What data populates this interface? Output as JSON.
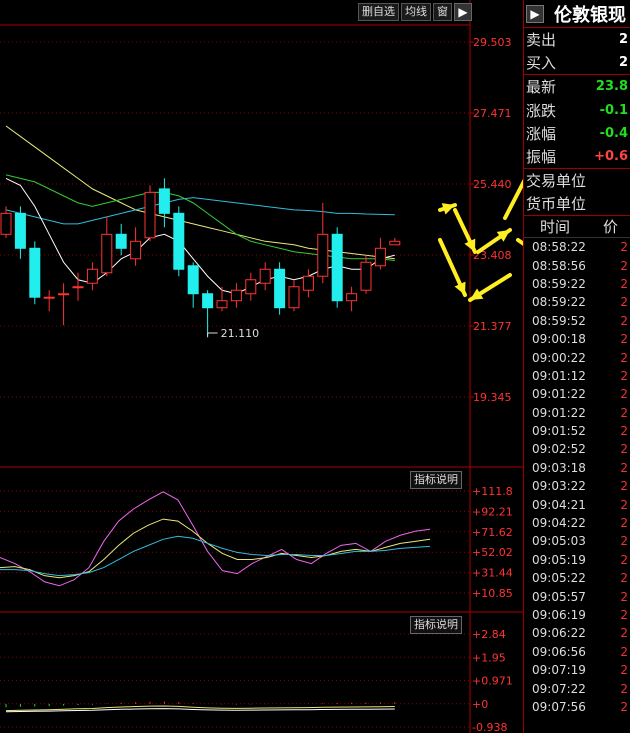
{
  "toolbar": {
    "delete_label": "删自选",
    "ma_label": "均线",
    "window_label": "窗",
    "arrow_icon": "play-icon"
  },
  "main_axis": {
    "labels": [
      "29.503",
      "27.471",
      "25.440",
      "23.408",
      "21.377",
      "19.345"
    ]
  },
  "min_label": "21.110",
  "indicator1": {
    "button_label": "指标说明",
    "labels": [
      "+111.8",
      "+92.21",
      "+71.62",
      "+52.02",
      "+31.44",
      "+10.85"
    ]
  },
  "indicator2": {
    "button_label": "指标说明",
    "labels": [
      "+2.84",
      "+1.95",
      "+0.971",
      "+0",
      "-0.938"
    ]
  },
  "panel": {
    "title": "伦敦银现",
    "rows": [
      {
        "label": "卖出",
        "value": "2",
        "color": "#ffffff"
      },
      {
        "label": "买入",
        "value": "2",
        "color": "#ffffff"
      },
      {
        "label": "最新",
        "value": "23.8",
        "color": "#22dd22"
      },
      {
        "label": "涨跌",
        "value": "-0.1",
        "color": "#22dd22"
      },
      {
        "label": "涨幅",
        "value": "-0.4",
        "color": "#22dd22"
      },
      {
        "label": "振幅",
        "value": "+0.6",
        "color": "#ff4444"
      },
      {
        "label": "交易单位",
        "value": "",
        "color": "#ffffff"
      },
      {
        "label": "货币单位",
        "value": "",
        "color": "#ffffff"
      }
    ],
    "tick_header": {
      "time": "时间",
      "price": "价"
    },
    "ticks": [
      {
        "time": "08:58:22",
        "value": "2"
      },
      {
        "time": "08:58:56",
        "value": "2"
      },
      {
        "time": "08:59:22",
        "value": "2"
      },
      {
        "time": "08:59:22",
        "value": "2"
      },
      {
        "time": "08:59:52",
        "value": "2"
      },
      {
        "time": "09:00:18",
        "value": "2"
      },
      {
        "time": "09:00:22",
        "value": "2"
      },
      {
        "time": "09:01:12",
        "value": "2"
      },
      {
        "time": "09:01:22",
        "value": "2"
      },
      {
        "time": "09:01:22",
        "value": "2"
      },
      {
        "time": "09:01:52",
        "value": "2"
      },
      {
        "time": "09:02:52",
        "value": "2"
      },
      {
        "time": "09:03:18",
        "value": "2"
      },
      {
        "time": "09:03:22",
        "value": "2"
      },
      {
        "time": "09:04:21",
        "value": "2"
      },
      {
        "time": "09:04:22",
        "value": "2"
      },
      {
        "time": "09:05:03",
        "value": "2"
      },
      {
        "time": "09:05:19",
        "value": "2"
      },
      {
        "time": "09:05:22",
        "value": "2"
      },
      {
        "time": "09:05:57",
        "value": "2"
      },
      {
        "time": "09:06:19",
        "value": "2"
      },
      {
        "time": "09:06:22",
        "value": "2"
      },
      {
        "time": "09:06:56",
        "value": "2"
      },
      {
        "time": "09:07:19",
        "value": "2"
      },
      {
        "time": "09:07:22",
        "value": "2"
      },
      {
        "time": "09:07:56",
        "value": "2"
      }
    ]
  },
  "colors": {
    "up": "#ff3333",
    "down": "#22eeee",
    "ma_yellow": "#e8e87a",
    "ma_white": "#ffffff",
    "ma_green": "#33cc33",
    "ma_cyan": "#33bbdd",
    "ma_magenta": "#ee66ee",
    "arrow_yellow": "#ffee22"
  },
  "chart_data": {
    "type": "candlestick",
    "ylim": [
      19.345,
      29.503
    ],
    "min_price": 21.11,
    "candles": [
      {
        "o": 24.0,
        "c": 24.6,
        "h": 24.8,
        "l": 23.9
      },
      {
        "o": 24.6,
        "c": 23.6,
        "h": 24.8,
        "l": 23.3
      },
      {
        "o": 23.6,
        "c": 22.2,
        "h": 23.8,
        "l": 22.0
      },
      {
        "o": 22.2,
        "c": 22.2,
        "h": 22.4,
        "l": 21.8
      },
      {
        "o": 22.3,
        "c": 22.3,
        "h": 22.6,
        "l": 21.4
      },
      {
        "o": 22.5,
        "c": 22.5,
        "h": 22.9,
        "l": 22.1
      },
      {
        "o": 22.6,
        "c": 23.0,
        "h": 23.2,
        "l": 22.4
      },
      {
        "o": 22.9,
        "c": 24.0,
        "h": 24.5,
        "l": 22.8
      },
      {
        "o": 24.0,
        "c": 23.6,
        "h": 24.3,
        "l": 23.4
      },
      {
        "o": 23.3,
        "c": 23.8,
        "h": 24.2,
        "l": 23.1
      },
      {
        "o": 23.9,
        "c": 25.2,
        "h": 25.4,
        "l": 23.8
      },
      {
        "o": 25.3,
        "c": 24.6,
        "h": 25.6,
        "l": 24.2
      },
      {
        "o": 24.6,
        "c": 23.0,
        "h": 24.8,
        "l": 22.8
      },
      {
        "o": 23.1,
        "c": 22.3,
        "h": 23.2,
        "l": 21.9
      },
      {
        "o": 22.3,
        "c": 21.9,
        "h": 22.4,
        "l": 21.1
      },
      {
        "o": 21.9,
        "c": 22.1,
        "h": 22.5,
        "l": 21.8
      },
      {
        "o": 22.1,
        "c": 22.4,
        "h": 22.6,
        "l": 21.9
      },
      {
        "o": 22.3,
        "c": 22.7,
        "h": 22.9,
        "l": 22.1
      },
      {
        "o": 22.6,
        "c": 23.0,
        "h": 23.2,
        "l": 22.4
      },
      {
        "o": 23.0,
        "c": 21.9,
        "h": 23.2,
        "l": 21.7
      },
      {
        "o": 21.9,
        "c": 22.5,
        "h": 22.7,
        "l": 21.8
      },
      {
        "o": 22.4,
        "c": 22.8,
        "h": 23.0,
        "l": 22.2
      },
      {
        "o": 22.8,
        "c": 24.0,
        "h": 24.9,
        "l": 22.6
      },
      {
        "o": 24.0,
        "c": 22.1,
        "h": 24.2,
        "l": 21.9
      },
      {
        "o": 22.1,
        "c": 22.3,
        "h": 22.5,
        "l": 21.8
      },
      {
        "o": 22.4,
        "c": 23.2,
        "h": 23.4,
        "l": 22.3
      },
      {
        "o": 23.1,
        "c": 23.6,
        "h": 23.9,
        "l": 23.0
      },
      {
        "o": 23.7,
        "c": 23.8,
        "h": 23.9,
        "l": 23.7
      }
    ],
    "ma_series": [
      {
        "color": "#e8e87a",
        "values": [
          27.1,
          26.8,
          26.5,
          26.2,
          25.9,
          25.6,
          25.3,
          25.1,
          24.9,
          24.7,
          24.6,
          24.5,
          24.4,
          24.3,
          24.2,
          24.1,
          24.0,
          23.9,
          23.8,
          23.75,
          23.7,
          23.6,
          23.55,
          23.5,
          23.45,
          23.4,
          23.35,
          23.3
        ]
      },
      {
        "color": "#33bbdd",
        "values": [
          24.7,
          24.6,
          24.5,
          24.4,
          24.3,
          24.3,
          24.4,
          24.5,
          24.6,
          24.7,
          24.8,
          24.9,
          25.0,
          25.05,
          25.0,
          24.95,
          24.9,
          24.85,
          24.8,
          24.75,
          24.7,
          24.68,
          24.65,
          24.6,
          24.6,
          24.58,
          24.57,
          24.56
        ]
      },
      {
        "color": "#33cc33",
        "values": [
          25.7,
          25.6,
          25.5,
          25.3,
          25.1,
          24.9,
          24.8,
          24.9,
          25.0,
          25.1,
          25.2,
          25.2,
          25.1,
          24.9,
          24.6,
          24.3,
          24.0,
          23.8,
          23.7,
          23.6,
          23.5,
          23.45,
          23.4,
          23.35,
          23.3,
          23.3,
          23.3,
          23.25
        ]
      },
      {
        "color": "#ffffff",
        "values": [
          25.6,
          25.4,
          24.8,
          24.0,
          23.2,
          22.7,
          22.6,
          22.9,
          23.3,
          23.5,
          23.9,
          24.0,
          23.8,
          23.3,
          22.8,
          22.4,
          22.3,
          22.5,
          22.7,
          22.8,
          22.7,
          22.8,
          23.0,
          23.1,
          23.0,
          23.0,
          23.3,
          23.4
        ]
      }
    ],
    "indicator1": {
      "ylim": [
        10.85,
        111.8
      ],
      "series": [
        {
          "color": "#ee66ee",
          "values": [
            46,
            40,
            32,
            22,
            18,
            24,
            36,
            62,
            82,
            94,
            103,
            111,
            103,
            78,
            52,
            33,
            30,
            40,
            47,
            54,
            44,
            40,
            50,
            58,
            60,
            52,
            62,
            68,
            72,
            74
          ]
        },
        {
          "color": "#e8e87a",
          "values": [
            36,
            37,
            34,
            28,
            26,
            28,
            32,
            44,
            58,
            70,
            78,
            84,
            82,
            72,
            60,
            50,
            44,
            44,
            46,
            50,
            48,
            46,
            48,
            52,
            54,
            52,
            56,
            60,
            62,
            64
          ]
        },
        {
          "color": "#33bbdd",
          "values": [
            34,
            34,
            33,
            30,
            28,
            29,
            31,
            36,
            44,
            52,
            58,
            64,
            67,
            65,
            60,
            55,
            51,
            49,
            48,
            49,
            49,
            48,
            48,
            50,
            52,
            52,
            53,
            55,
            56,
            57
          ]
        }
      ]
    },
    "indicator2": {
      "ylim": [
        -0.938,
        2.84
      ],
      "macd": [
        -0.9,
        -0.8,
        -0.7,
        -0.6,
        -0.45,
        -0.3,
        -0.2,
        0.1,
        0.3,
        0.45,
        0.6,
        0.65,
        0.5,
        0.2,
        0.0,
        -0.1,
        -0.15,
        -0.1,
        -0.05,
        0.0,
        0.05,
        0.1,
        0.2,
        0.25,
        0.3,
        0.35,
        0.4,
        0.45
      ]
    }
  }
}
